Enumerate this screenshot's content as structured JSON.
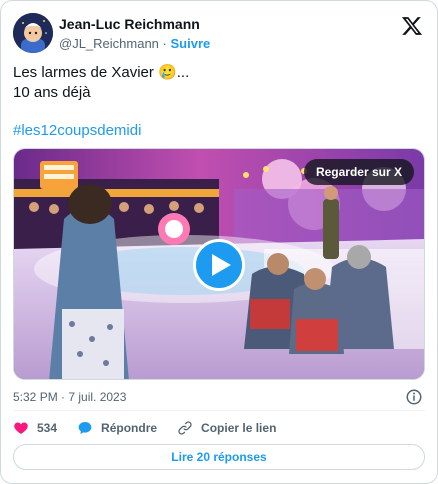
{
  "user": {
    "display_name": "Jean-Luc Reichmann",
    "handle": "@JL_Reichmann",
    "separator": "·",
    "follow_label": "Suivre"
  },
  "tweet": {
    "line1": "Les larmes de Xavier 🥲...",
    "line2": "10 ans déjà",
    "hashtag": "#les12coupsdemidi"
  },
  "media": {
    "watch_label": "Regarder sur X"
  },
  "meta": {
    "timestamp": "5:32 PM · 7 juil. 2023"
  },
  "actions": {
    "like_count": "534",
    "reply_label": "Répondre",
    "copy_label": "Copier le lien"
  },
  "footer": {
    "replies_label": "Lire 20 réponses"
  },
  "colors": {
    "accent": "#1d9bf0",
    "like": "#f91880",
    "text": "#0f1419",
    "muted": "#536471"
  }
}
